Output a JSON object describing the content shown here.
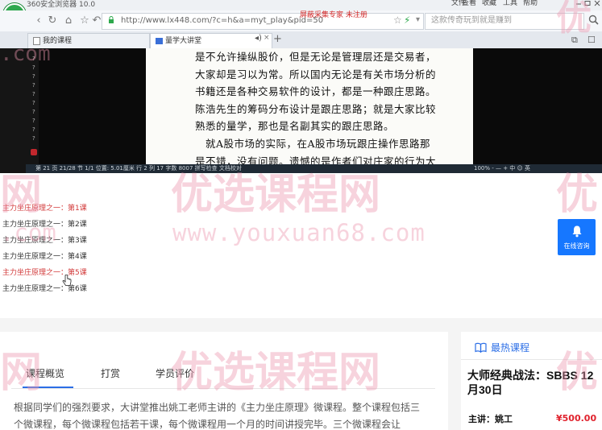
{
  "browser": {
    "name": "360安全浏览器 10.0",
    "logo_glyph": "e",
    "menu": [
      "文件",
      "查看",
      "收藏",
      "工具",
      "帮助"
    ],
    "url": "http://www.lx448.com/?c=h&a=myt_play&pid=50",
    "ad_text": "屏蔽采集专家 未注册",
    "search_placeholder": "这款传奇玩到就是赚到",
    "tabs": [
      {
        "label": "我的课程"
      },
      {
        "label": "量学大讲堂"
      }
    ],
    "new_tab": "+"
  },
  "video": {
    "left_glyphs": [
      "?",
      "?",
      "?",
      "?",
      "?",
      "?",
      "?",
      "?",
      "?",
      "?"
    ],
    "doc_lines": [
      "是不允许操纵股价，但是无论是管理层还是交易者，",
      "大家却是习以为常。所以国内无论是有关市场分析的",
      "书籍还是各种交易软件的设计，都是一种跟庄思路。",
      "陈浩先生的筹码分布设计是跟庄思路；就是大家比较",
      "熟悉的量学，那也是名副其实的跟庄思路。",
      "　就A股市场的实际，在A股市场玩跟庄操作思路那",
      "是不错，没有问题。遗憾的是作者们对庄家的行为大"
    ],
    "status_text": "第 21 页  21/28  节 1/1  位置: 5.01厘米  行 2  列 17  字数 8007  拼写检查  文档校对",
    "status_right": "100% -  —  + 中 ☺ 英"
  },
  "lessons": [
    {
      "prefix": "主力坐庄原理之一：",
      "num": "第1课",
      "active": true
    },
    {
      "prefix": "主力坐庄原理之一：",
      "num": "第2课",
      "active": false
    },
    {
      "prefix": "主力坐庄原理之一：",
      "num": "第3课",
      "active": false
    },
    {
      "prefix": "主力坐庄原理之一：",
      "num": "第4课",
      "active": false
    },
    {
      "prefix": "主力坐庄原理之一：",
      "num": "第5课",
      "active": true
    },
    {
      "prefix": "主力坐庄原理之一：",
      "num": "第6课",
      "active": false
    }
  ],
  "chat": {
    "label": "在线咨询",
    "color": "#1677ff"
  },
  "course_tabs": [
    "课程概览",
    "打赏",
    "学员评价"
  ],
  "description_lines": [
    "根据同学们的强烈要求，大讲堂推出姚工老师主讲的《主力坐庄原理》微课程。整个课程包括三",
    "个微课程，每个微课程包括若干课，每个微课程用一个月的时间讲授完毕。三个微课程会让"
  ],
  "hot": {
    "title": "最热课程",
    "course_title": "大师经典战法：SBBS 12月30日",
    "teacher": "主讲：姚工",
    "price": "¥500.00"
  },
  "watermark": {
    "main": "优选课程网",
    "side": "优",
    "side_left": "网",
    "url": "www.youxuan68.com",
    "url_short": ".com"
  },
  "colors": {
    "accent": "#2b6ee6",
    "active_lesson": "#d23a3a",
    "price": "#e0222d"
  }
}
